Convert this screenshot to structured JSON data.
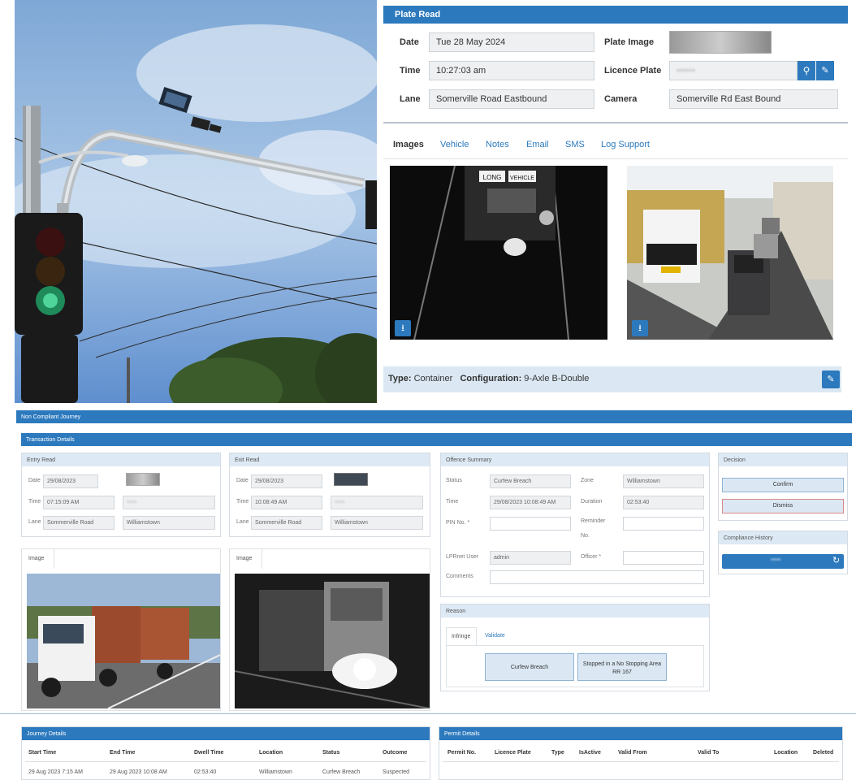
{
  "plate_read": {
    "title": "Plate Read",
    "date_label": "Date",
    "date_value": "Tue 28 May 2024",
    "time_label": "Time",
    "time_value": "10:27:03 am",
    "lane_label": "Lane",
    "lane_value": "Somerville Road Eastbound",
    "plate_image_label": "Plate Image",
    "licence_plate_label": "Licence Plate",
    "camera_label": "Camera",
    "camera_value": "Somerville Rd East Bound",
    "tabs": [
      "Images",
      "Vehicle",
      "Notes",
      "Email",
      "SMS",
      "Log Support"
    ],
    "active_tab": "Images",
    "type_label": "Type:",
    "type_value": "Container",
    "configuration_label": "Configuration:",
    "configuration_value": "9-Axle B-Double",
    "ir_sign_text_1": "LONG",
    "ir_sign_text_2": "VEHICLE"
  },
  "ncj": {
    "title": "Non Compliant Journey",
    "transaction_title": "Transaction Details",
    "entry_read": {
      "title": "Entry Read",
      "date_label": "Date",
      "date_value": "29/08/2023",
      "time_label": "Time",
      "time_value": "07:15:09 AM",
      "lane_label": "Lane",
      "lane_value": "Sommerville Road",
      "zone_value": "Williamstown",
      "image_tab": "Image"
    },
    "exit_read": {
      "title": "Exit Read",
      "date_label": "Date",
      "date_value": "29/08/2023",
      "time_label": "Time",
      "time_value": "10:08:49 AM",
      "lane_label": "Lane",
      "lane_value": "Sommerville Road",
      "zone_value": "Williamstown",
      "image_tab": "Image"
    },
    "offence": {
      "title": "Offence Summary",
      "status_label": "Status",
      "status_value": "Curfew Breach",
      "zone_label": "Zone",
      "zone_value": "Williamstown",
      "time_label": "Time",
      "time_value": "29/08/2023 10:08:49 AM",
      "duration_label": "Duration",
      "duration_value": "02:53:40",
      "pin_label": "PIN No. *",
      "reminder_label_1": "Reminder",
      "reminder_label_2": "No.",
      "lprnet_label": "LPRnet User",
      "lprnet_value": "admin",
      "officer_label": "Officer *",
      "comments_label": "Comments"
    },
    "reason": {
      "title": "Reason",
      "tabs": [
        "Infringe",
        "Validate"
      ],
      "btn_curfew": "Curfew Breach",
      "btn_stopped_1": "Stopped in a No Stopping Area",
      "btn_stopped_2": "RR 167"
    },
    "decision": {
      "title": "Decision",
      "confirm": "Confirm",
      "dismiss": "Dismiss"
    },
    "compliance_history": {
      "title": "Compliance History"
    },
    "journey": {
      "title": "Journey Details",
      "headers": [
        "Start Time",
        "End Time",
        "Dwell Time",
        "Location",
        "Status",
        "Outcome"
      ],
      "row": [
        "29 Aug 2023 7:15 AM",
        "29 Aug 2023 10:08 AM",
        "02:53:40",
        "Williamstown",
        "Curfew Breach",
        "Suspected"
      ]
    },
    "permit": {
      "title": "Permit Details",
      "headers": [
        "Permit No.",
        "Licence Plate",
        "Type",
        "IsActive",
        "Valid From",
        "Valid To",
        "Location",
        "Deleted"
      ]
    }
  },
  "colors": {
    "accent": "#2c79bd",
    "panel_light": "#dde9f4"
  },
  "icons": {
    "search": "search-icon",
    "edit": "pencil-icon",
    "download": "download-icon",
    "refresh": "refresh-icon"
  }
}
